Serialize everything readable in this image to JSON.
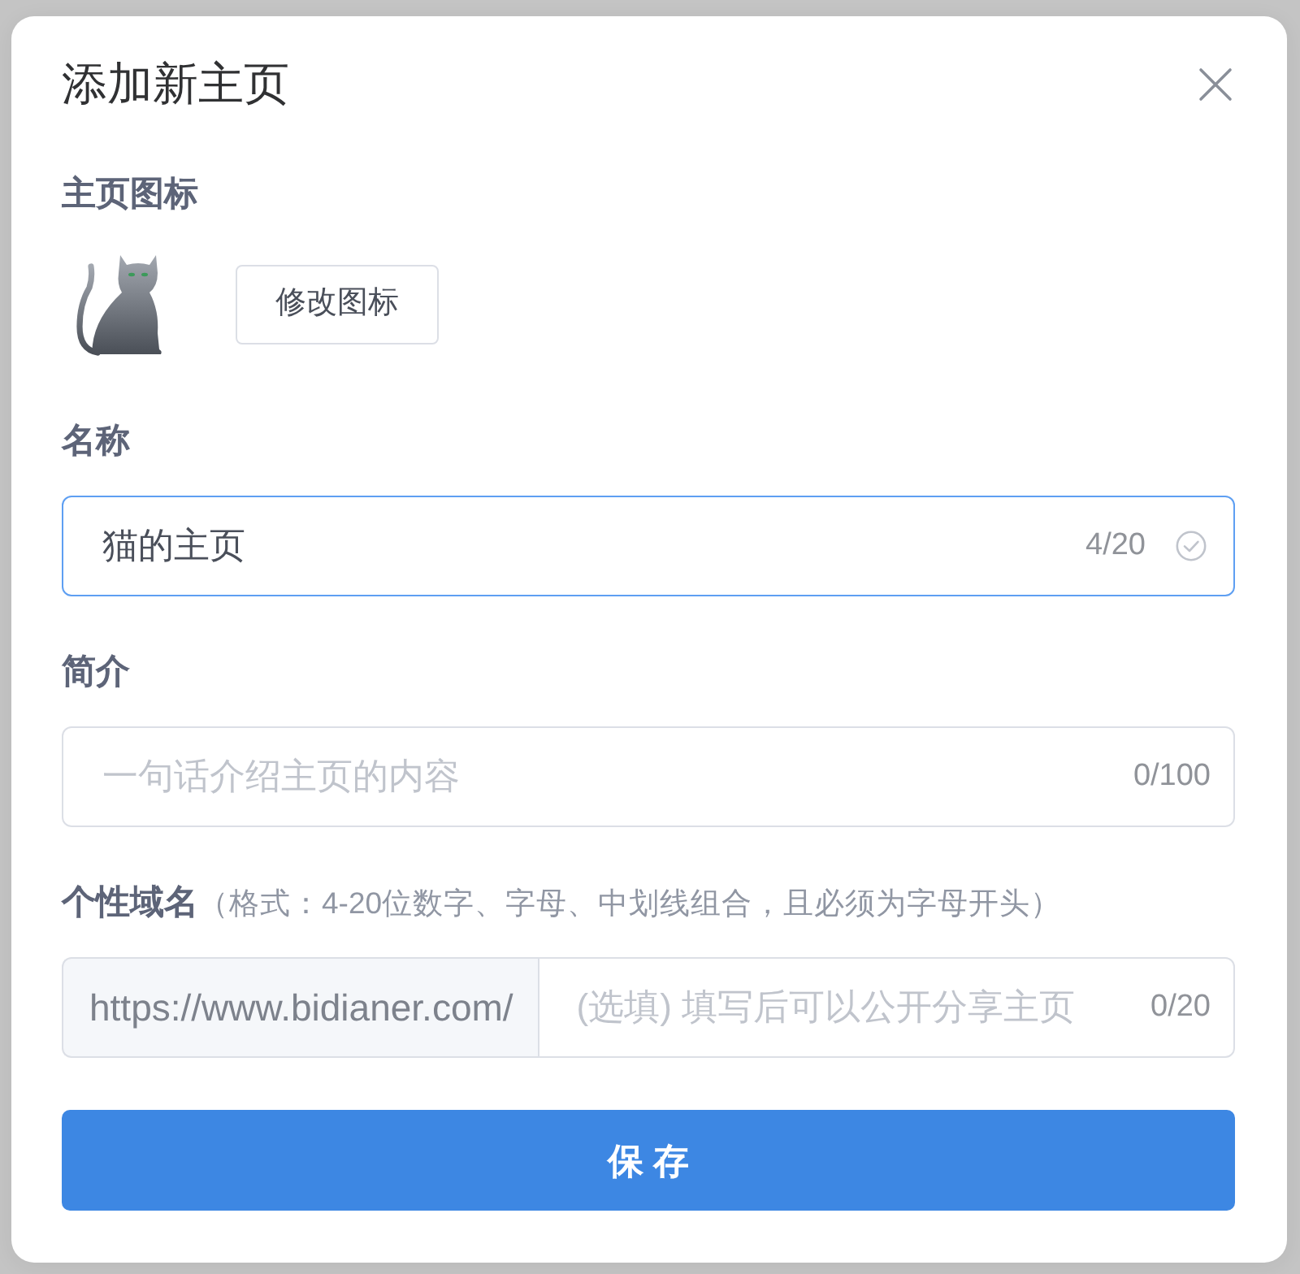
{
  "dialog": {
    "title": "添加新主页"
  },
  "icon_section": {
    "label": "主页图标",
    "button": "修改图标"
  },
  "fields": [
    {
      "kind": "text",
      "label": "名称",
      "value": "猫的主页",
      "counter": "4/20",
      "focused": true,
      "valid": true
    },
    {
      "kind": "text",
      "label": "简介",
      "placeholder": "一句话介绍主页的内容",
      "counter": "0/100",
      "focused": false,
      "valid": false
    },
    {
      "kind": "prefixed",
      "label": "个性域名",
      "hint": "（格式：4-20位数字、字母、中划线组合，且必须为字母开头）",
      "prefix": "https://www.bidianer.com/",
      "placeholder": "(选填) 填写后可以公开分享主页",
      "counter": "0/20",
      "focused": false,
      "valid": false
    }
  ],
  "save_button": "保 存"
}
